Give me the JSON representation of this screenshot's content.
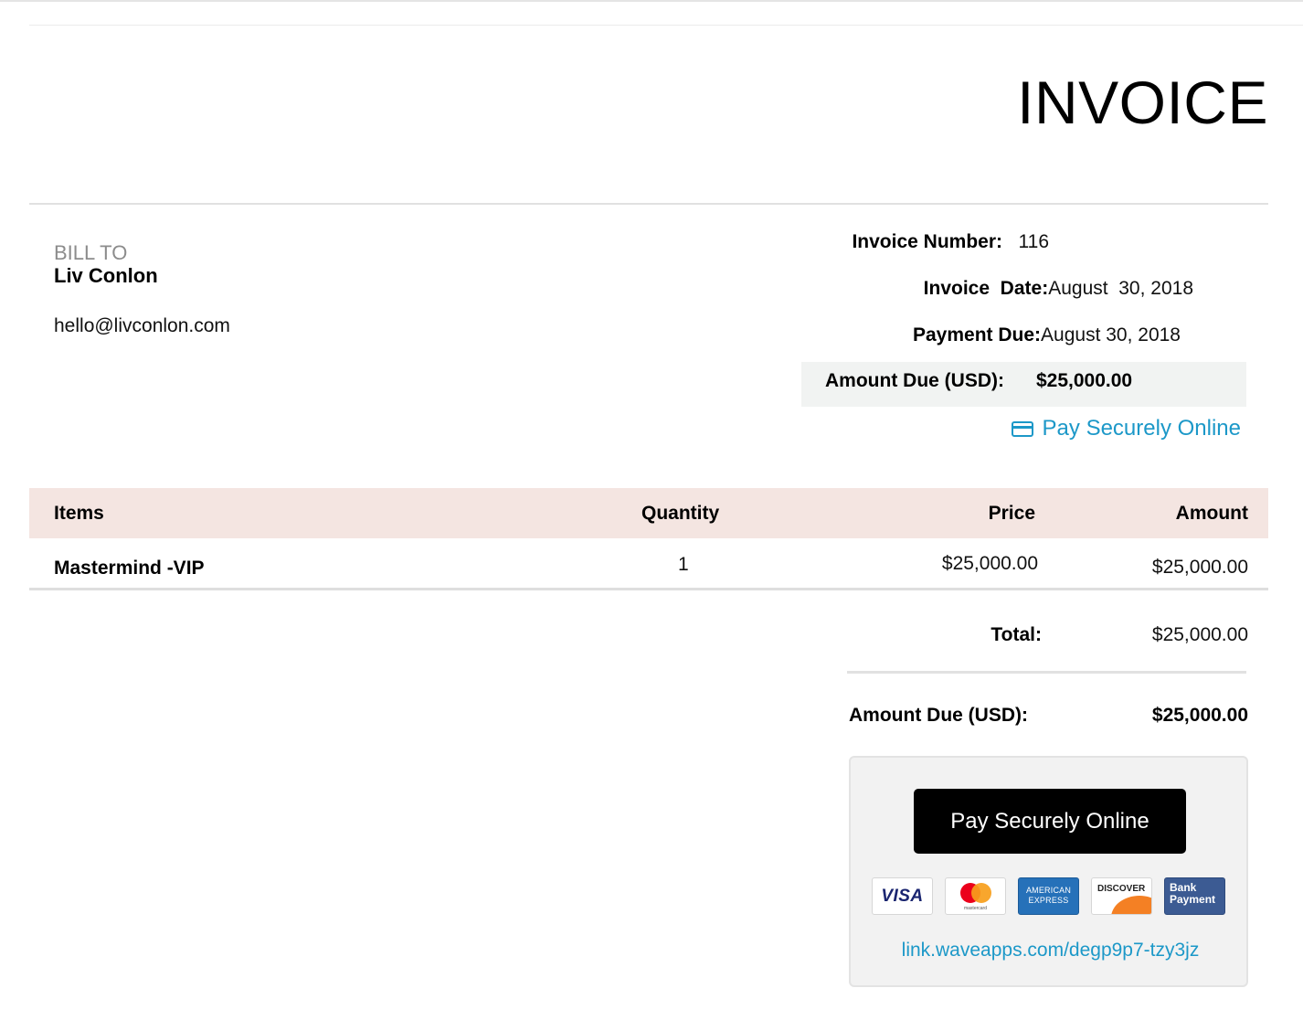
{
  "title": "INVOICE",
  "bill_to": {
    "label": "BILL TO",
    "name": "Liv Conlon",
    "email": "hello@livconlon.com"
  },
  "meta": {
    "invoice_number_label": "Invoice Number:",
    "invoice_number": "116",
    "invoice_date_label": "Invoice  Date:",
    "invoice_date": "August  30, 2018",
    "payment_due_label": "Payment Due:",
    "payment_due": "August 30, 2018",
    "amount_due_label": "Amount Due (USD):",
    "amount_due": "$25,000.00"
  },
  "pay_link_top": "Pay Securely Online",
  "items_table": {
    "headers": {
      "items": "Items",
      "quantity": "Quantity",
      "price": "Price",
      "amount": "Amount"
    },
    "rows": [
      {
        "item": "Mastermind -VIP",
        "quantity": "1",
        "price": "$25,000.00",
        "amount": "$25,000.00"
      }
    ]
  },
  "totals": {
    "total_label": "Total:",
    "total_value": "$25,000.00",
    "amount_due_label": "Amount Due (USD):",
    "amount_due_value": "$25,000.00"
  },
  "payment_panel": {
    "button_label": "Pay Securely Online",
    "cards": {
      "visa": "VISA",
      "mastercard": "mastercard",
      "amex": "AMERICAN EXPRESS",
      "discover": "DISCOVER",
      "bank": "Bank Payment"
    },
    "link": "link.waveapps.com/degp9p7-tzy3jz"
  },
  "colors": {
    "link": "#1c98c8",
    "table_header_bg": "#f4e5e1",
    "amount_box_bg": "#f1f3f2",
    "button_bg": "#000000"
  },
  "icons": [
    "credit-card-icon",
    "visa-logo",
    "mastercard-logo",
    "amex-logo",
    "discover-logo",
    "bank-payment-logo"
  ]
}
